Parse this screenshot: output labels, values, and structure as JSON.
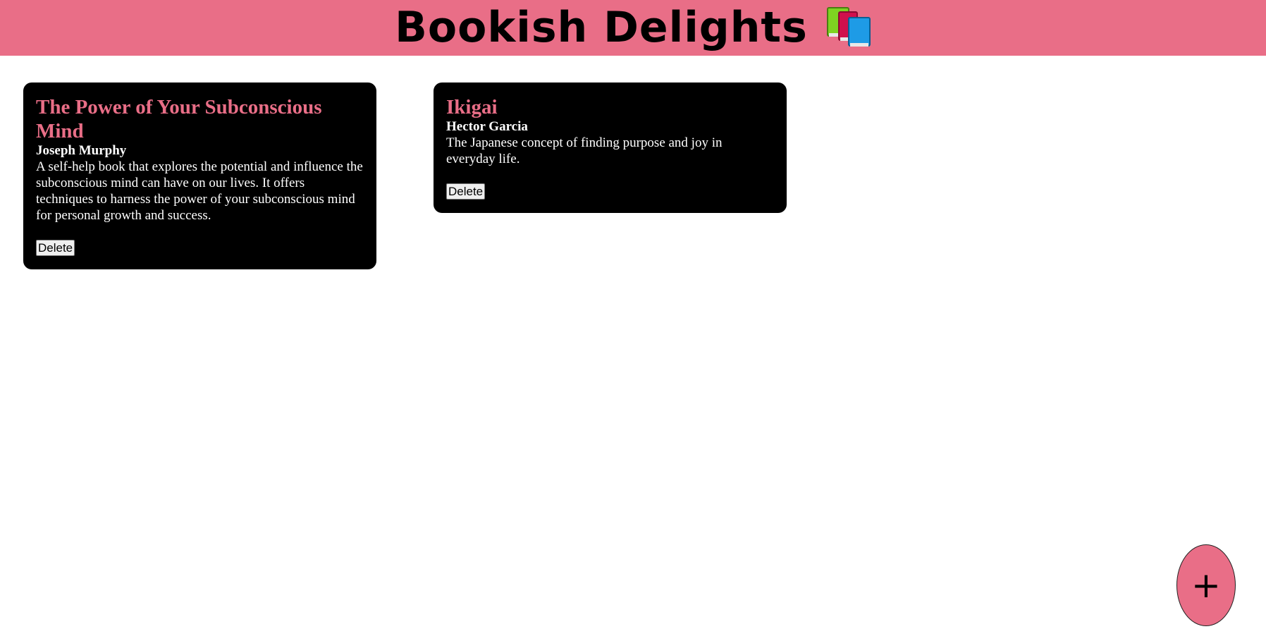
{
  "header": {
    "title": "Bookish Delights",
    "icon": "books-icon",
    "background": "#e96e87"
  },
  "books": [
    {
      "title": "The Power of Your Subconscious Mind",
      "author": "Joseph Murphy",
      "description": "A self-help book that explores the potential and influence the subconscious mind can have on our lives. It offers techniques to harness the power of your subconscious mind for personal growth and success.",
      "delete_label": "Delete"
    },
    {
      "title": "Ikigai",
      "author": "Hector Garcia",
      "description": "The Japanese concept of finding purpose and joy in everyday life.",
      "delete_label": "Delete"
    }
  ],
  "add_button": {
    "label": "+"
  },
  "colors": {
    "accent": "#e96e87",
    "card_background": "#000000",
    "card_text": "#ffffff"
  }
}
